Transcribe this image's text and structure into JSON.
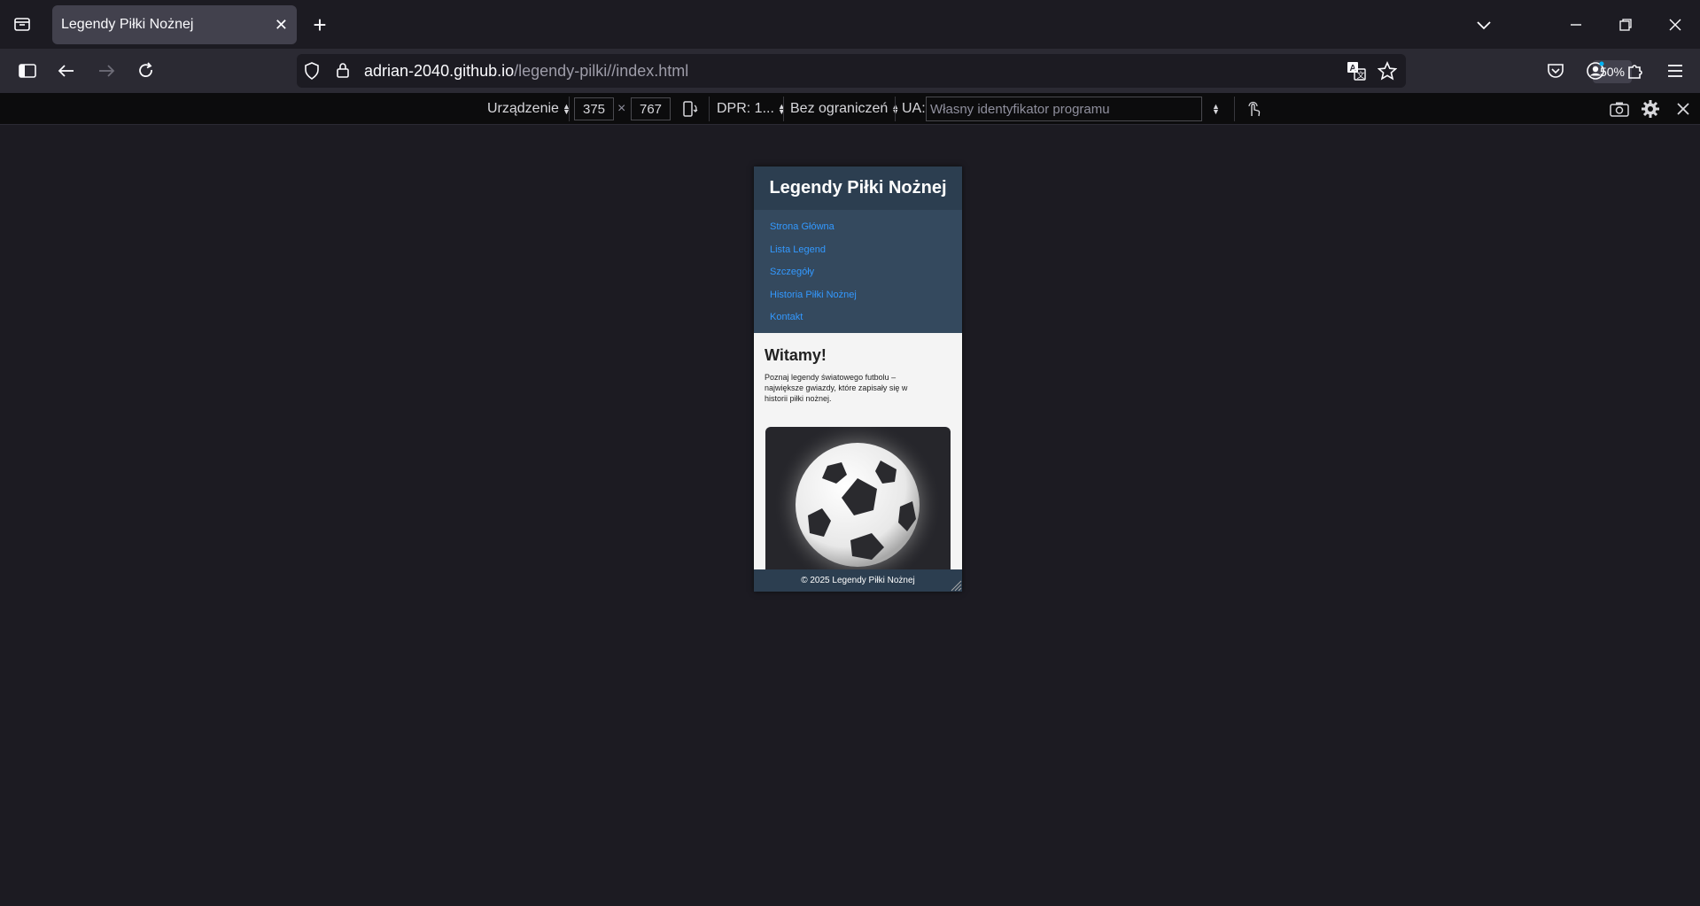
{
  "browser": {
    "tab": {
      "title": "Legendy Piłki Nożnej",
      "close_icon": "close-icon"
    },
    "url": {
      "host": "adrian-2040.github.io",
      "path": "/legendy-pilki//index.html"
    },
    "zoom": "50%"
  },
  "rdm": {
    "device_label": "Urządzenie",
    "width": "375",
    "times": "×",
    "height": "767",
    "dpr_label": "DPR: 1...",
    "throttle_label": "Bez ograniczeń",
    "ua_label": "UA:",
    "ua_placeholder": "Własny identyfikator programu"
  },
  "site": {
    "header_title": "Legendy Piłki Nożnej",
    "nav": [
      "Strona Główna",
      "Lista Legend",
      "Szczegóły",
      "Historia Piłki Nożnej",
      "Kontakt"
    ],
    "welcome_heading": "Witamy!",
    "intro_text": "Poznaj legendy światowego futbolu – największe gwiazdy, które zapisały się w historii piłki nożnej.",
    "footer_text": "© 2025 Legendy Piłki Nożnej"
  },
  "colors": {
    "header_bg": "#2c3e50",
    "nav_bg": "#34495e",
    "link": "#3399ff",
    "page_bg": "#f4f4f4"
  }
}
